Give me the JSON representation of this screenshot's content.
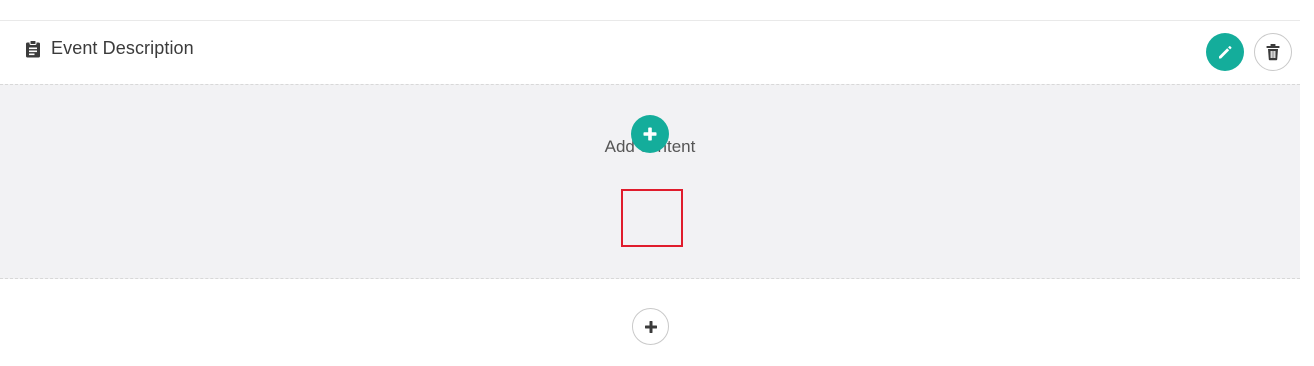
{
  "section": {
    "title": "Event Description",
    "icon": "clipboard-icon"
  },
  "actions": {
    "edit_icon": "pencil-icon",
    "delete_icon": "trash-icon"
  },
  "content": {
    "label": "Add content",
    "add_icon": "plus-icon",
    "highlighted": true
  },
  "add_section": {
    "icon": "plus-icon"
  },
  "colors": {
    "accent": "#14ad9b",
    "highlight": "#e01c2c",
    "content_bg": "#f2f2f4",
    "text": "#3b3b3b"
  }
}
